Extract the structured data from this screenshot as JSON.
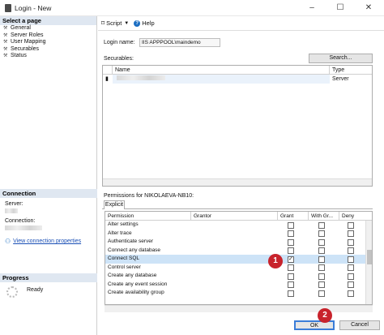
{
  "window": {
    "title": "Login - New",
    "controls": [
      "–",
      "☐",
      "✕"
    ]
  },
  "left_panel": {
    "select_page_header": "Select a page",
    "pages": [
      "General",
      "Server Roles",
      "User Mapping",
      "Securables",
      "Status"
    ],
    "connection_header": "Connection",
    "server_label": "Server:",
    "connection_label": "Connection:",
    "view_connection_link": "View connection properties",
    "progress_header": "Progress",
    "progress_status": "Ready"
  },
  "toolbar": {
    "script_label": "Script",
    "help_label": "Help"
  },
  "form": {
    "login_name_label": "Login name:",
    "login_name_value": "IIS APPPOOL\\maindemo",
    "securables_label": "Securables:",
    "search_button": "Search..."
  },
  "securables_grid": {
    "columns": [
      "Name",
      "Type"
    ],
    "rows": [
      {
        "type": "Server"
      }
    ]
  },
  "permissions": {
    "label": "Permissions for NIKOLAEVA-NB10:",
    "tab": "Explicit",
    "columns": [
      "Permission",
      "Grantor",
      "Grant",
      "With Gr...",
      "Deny"
    ],
    "rows": [
      {
        "name": "Alter settings",
        "grant": false,
        "with_grant": false,
        "deny": false,
        "selected": false
      },
      {
        "name": "Alter trace",
        "grant": false,
        "with_grant": false,
        "deny": false,
        "selected": false
      },
      {
        "name": "Authenticate server",
        "grant": false,
        "with_grant": false,
        "deny": false,
        "selected": false
      },
      {
        "name": "Connect any database",
        "grant": false,
        "with_grant": false,
        "deny": false,
        "selected": false
      },
      {
        "name": "Connect SQL",
        "grant": true,
        "with_grant": false,
        "deny": false,
        "selected": true
      },
      {
        "name": "Control server",
        "grant": false,
        "with_grant": false,
        "deny": false,
        "selected": false
      },
      {
        "name": "Create any database",
        "grant": false,
        "with_grant": false,
        "deny": false,
        "selected": false
      },
      {
        "name": "Create any event session",
        "grant": false,
        "with_grant": false,
        "deny": false,
        "selected": false
      },
      {
        "name": "Create availability group",
        "grant": false,
        "with_grant": false,
        "deny": false,
        "selected": false
      }
    ]
  },
  "buttons": {
    "ok": "OK",
    "cancel": "Cancel"
  },
  "callouts": {
    "one": "1",
    "two": "2"
  },
  "colors": {
    "accent_red": "#c8232c",
    "selection": "#cde3f7",
    "section_header": "#dfe7f1",
    "link": "#1a4fb5"
  }
}
